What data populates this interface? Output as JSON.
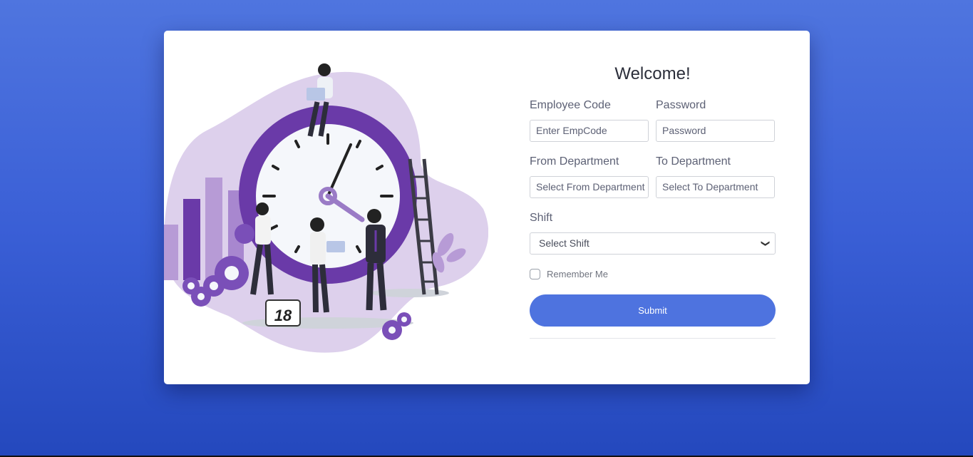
{
  "form": {
    "title": "Welcome!",
    "employee_code": {
      "label": "Employee Code",
      "placeholder": "Enter EmpCode"
    },
    "password": {
      "label": "Password",
      "placeholder": "Password"
    },
    "from_department": {
      "label": "From Department",
      "placeholder": "Select From Department"
    },
    "to_department": {
      "label": "To Department",
      "placeholder": "Select To Department"
    },
    "shift": {
      "label": "Shift",
      "selected": "Select Shift"
    },
    "remember_me": {
      "label": "Remember Me",
      "checked": false
    },
    "submit_label": "Submit"
  },
  "illustration": {
    "calendar_day": "18"
  },
  "colors": {
    "background_top": "#4f75df",
    "background_bottom": "#2448bd",
    "accent": "#4e73df",
    "illustration_purple": "#6a3aa8",
    "illustration_lavender": "#ddd0ec"
  }
}
